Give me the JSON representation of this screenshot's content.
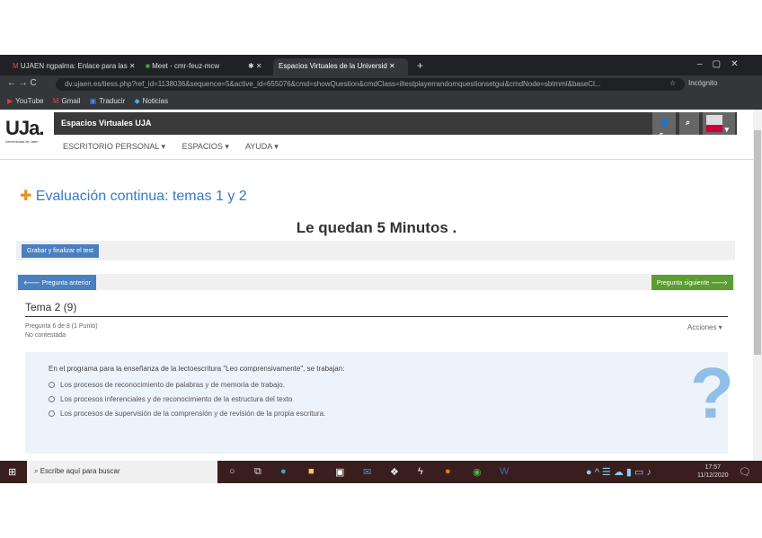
{
  "browser": {
    "tabs": [
      "UJAEN ngpalma: Enlace para las",
      "Meet - cmr-feuz-mcw",
      "",
      "Espacios Virtuales de la Universid"
    ],
    "url": "dv.ujaen.es/tiess.php?ref_id=1138036&sequence=5&active_id=655076&cmd=showQuestion&cmdClass=iltestplayerrandomquestionsetgui&cmdNode=sbtmml&baseCl...",
    "profile": "Incógnito",
    "bookmarks": [
      "YouTube",
      "Gmail",
      "Traducir",
      "Noticias"
    ]
  },
  "site": {
    "logo": "UJa.",
    "logo_sub": "Universidad de Jaén",
    "title": "Espacios Virtuales UJA",
    "nav": [
      "ESCRITORIO PERSONAL ▾",
      "ESPACIOS ▾",
      "AYUDA ▾"
    ],
    "notif_count": "5"
  },
  "test": {
    "title": "Evaluación continua: temas 1 y 2",
    "timer": "Le quedan 5 Minutos .",
    "finish": "Grabar y finalizar el test",
    "prev": "🡐 Pregunta anterior",
    "next": "Pregunta siguiente 🡒",
    "section": "Tema 2 (9)",
    "question_of": "Pregunta 6 de 8 (1 Punto)",
    "status": "No contestada",
    "actions": "Acciones ▾",
    "question": "En el programa para la enseñanza de la lectoescritura \"Leo comprensivamente\", se trabajan:",
    "options": [
      "Los procesos de reconocimiento de palabras y de memoria de trabajo.",
      "Los procesos inferenciales y de reconocimiento de la estructura del texto",
      "Los procesos de supervisión de la comprensión y de revisión de la propia escritura."
    ]
  },
  "taskbar": {
    "search": "Escribe aquí para buscar",
    "time": "17:57",
    "date": "11/12/2020"
  }
}
